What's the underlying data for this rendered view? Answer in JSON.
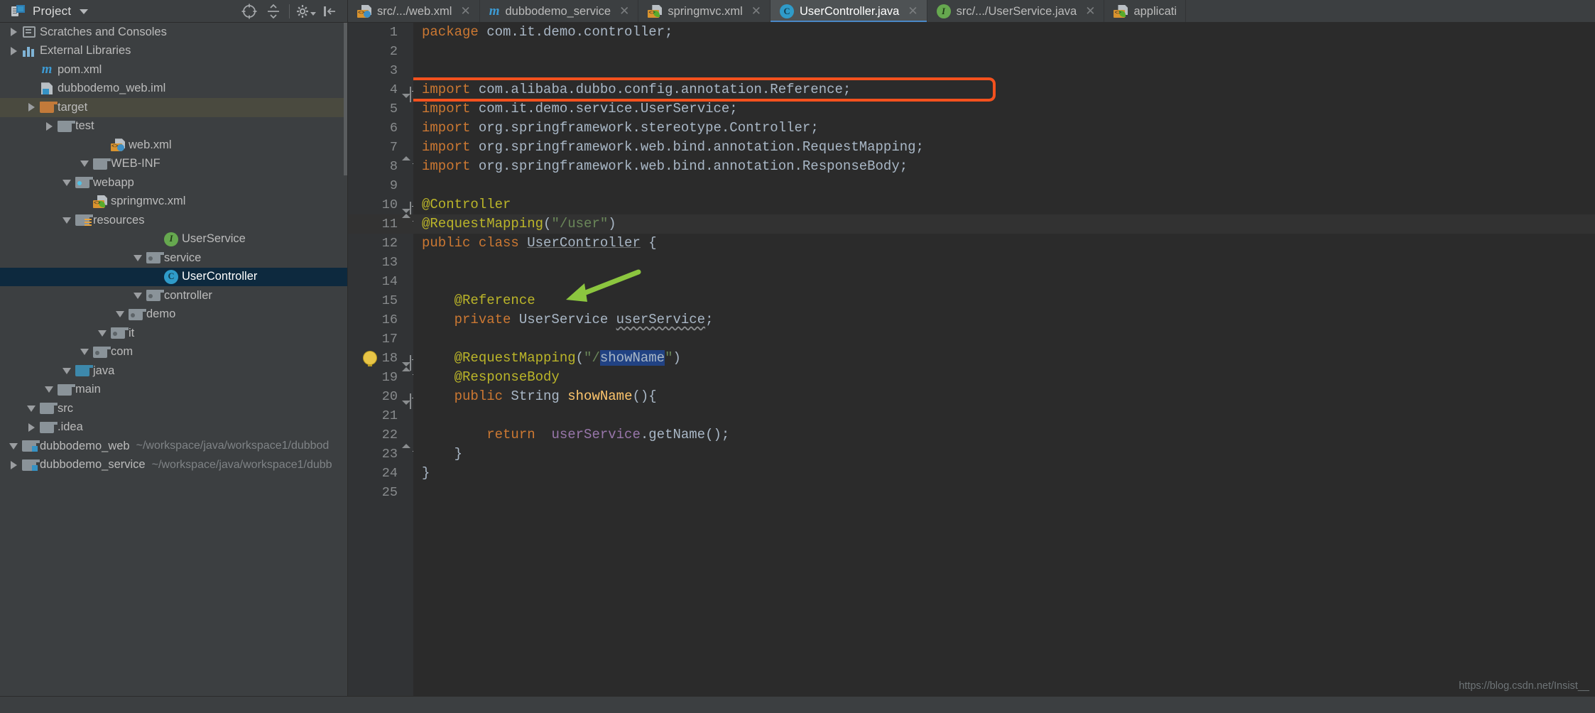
{
  "toolwindow": {
    "title": "Project",
    "icons": [
      "locate-icon",
      "collapse-all-icon",
      "settings-gear-icon",
      "hide-panel-icon"
    ]
  },
  "tabs": [
    {
      "label": "src/.../web.xml",
      "icon": "xml-web-file-icon",
      "active": false,
      "close": "✕"
    },
    {
      "label": "dubbodemo_service",
      "icon": "maven-module-icon",
      "active": false,
      "close": "✕"
    },
    {
      "label": "springmvc.xml",
      "icon": "spring-xml-file-icon",
      "active": false,
      "close": "✕"
    },
    {
      "label": "UserController.java",
      "icon": "java-class-icon",
      "active": true,
      "close": "✕"
    },
    {
      "label": "src/.../UserService.java",
      "icon": "java-interface-icon",
      "active": false,
      "close": "✕"
    },
    {
      "label": "applicati",
      "icon": "spring-xml-file-icon",
      "active": false,
      "close": ""
    }
  ],
  "tree": [
    {
      "label": "dubbodemo_service",
      "path": "~/workspace/java/workspace1/dubb",
      "indent": 0,
      "arrow": "right",
      "icon": "module-folder-icon"
    },
    {
      "label": "dubbodemo_web",
      "path": "~/workspace/java/workspace1/dubbod",
      "indent": 0,
      "arrow": "down",
      "icon": "module-folder-icon"
    },
    {
      "label": ".idea",
      "path": "",
      "indent": 1,
      "arrow": "right",
      "icon": "folder-icon"
    },
    {
      "label": "src",
      "path": "",
      "indent": 1,
      "arrow": "down",
      "icon": "folder-icon"
    },
    {
      "label": "main",
      "path": "",
      "indent": 2,
      "arrow": "down",
      "icon": "folder-icon"
    },
    {
      "label": "java",
      "path": "",
      "indent": 3,
      "arrow": "down",
      "icon": "source-root-folder-icon"
    },
    {
      "label": "com",
      "path": "",
      "indent": 4,
      "arrow": "down",
      "icon": "package-folder-icon"
    },
    {
      "label": "it",
      "path": "",
      "indent": 5,
      "arrow": "down",
      "icon": "package-folder-icon"
    },
    {
      "label": "demo",
      "path": "",
      "indent": 6,
      "arrow": "down",
      "icon": "package-folder-icon"
    },
    {
      "label": "controller",
      "path": "",
      "indent": 7,
      "arrow": "down",
      "icon": "package-folder-icon"
    },
    {
      "label": "UserController",
      "path": "",
      "indent": 8,
      "arrow": "none",
      "icon": "java-class-icon",
      "selected": true
    },
    {
      "label": "service",
      "path": "",
      "indent": 7,
      "arrow": "down",
      "icon": "package-folder-icon"
    },
    {
      "label": "UserService",
      "path": "",
      "indent": 8,
      "arrow": "none",
      "icon": "java-interface-icon"
    },
    {
      "label": "resources",
      "path": "",
      "indent": 3,
      "arrow": "down",
      "icon": "resource-root-folder-icon"
    },
    {
      "label": "springmvc.xml",
      "path": "",
      "indent": 4,
      "arrow": "none",
      "icon": "spring-xml-file-icon"
    },
    {
      "label": "webapp",
      "path": "",
      "indent": 3,
      "arrow": "down",
      "icon": "web-root-folder-icon"
    },
    {
      "label": "WEB-INF",
      "path": "",
      "indent": 4,
      "arrow": "down",
      "icon": "folder-icon"
    },
    {
      "label": "web.xml",
      "path": "",
      "indent": 5,
      "arrow": "none",
      "icon": "xml-web-file-icon"
    },
    {
      "label": "test",
      "path": "",
      "indent": 2,
      "arrow": "right",
      "icon": "folder-icon"
    },
    {
      "label": "target",
      "path": "",
      "indent": 1,
      "arrow": "right",
      "icon": "excluded-folder-icon",
      "highlight": true
    },
    {
      "label": "dubbodemo_web.iml",
      "path": "",
      "indent": 1,
      "arrow": "none",
      "icon": "iml-file-icon"
    },
    {
      "label": "pom.xml",
      "path": "",
      "indent": 1,
      "arrow": "none",
      "icon": "maven-pom-icon"
    },
    {
      "label": "External Libraries",
      "path": "",
      "indent": 0,
      "arrow": "right",
      "icon": "libraries-icon"
    },
    {
      "label": "Scratches and Consoles",
      "path": "",
      "indent": 0,
      "arrow": "right",
      "icon": "scratches-icon"
    }
  ],
  "editor": {
    "line_numbers": [
      "1",
      "2",
      "3",
      "4",
      "5",
      "6",
      "7",
      "8",
      "9",
      "10",
      "11",
      "12",
      "13",
      "14",
      "15",
      "16",
      "17",
      "18",
      "19",
      "20",
      "21",
      "22",
      "23",
      "24",
      "25"
    ],
    "current_line": 11,
    "lines": [
      {
        "n": 1,
        "tokens": [
          {
            "t": "package ",
            "c": "kw"
          },
          {
            "t": "com.it.demo.controller;",
            "c": "plain"
          }
        ]
      },
      {
        "n": 2,
        "tokens": []
      },
      {
        "n": 3,
        "tokens": []
      },
      {
        "n": 4,
        "tokens": [
          {
            "t": "import ",
            "c": "kw"
          },
          {
            "t": "com.alibaba.dubbo.config.annotation.",
            "c": "plain"
          },
          {
            "t": "Reference",
            "c": "type"
          },
          {
            "t": ";",
            "c": "plain"
          }
        ]
      },
      {
        "n": 5,
        "tokens": [
          {
            "t": "import ",
            "c": "kw"
          },
          {
            "t": "com.it.demo.service.",
            "c": "plain"
          },
          {
            "t": "UserService",
            "c": "type"
          },
          {
            "t": ";",
            "c": "plain"
          }
        ]
      },
      {
        "n": 6,
        "tokens": [
          {
            "t": "import ",
            "c": "kw"
          },
          {
            "t": "org.springframework.stereotype.",
            "c": "plain"
          },
          {
            "t": "Controller",
            "c": "type"
          },
          {
            "t": ";",
            "c": "plain"
          }
        ]
      },
      {
        "n": 7,
        "tokens": [
          {
            "t": "import ",
            "c": "kw"
          },
          {
            "t": "org.springframework.web.bind.annotation.",
            "c": "plain"
          },
          {
            "t": "RequestMapping",
            "c": "type"
          },
          {
            "t": ";",
            "c": "plain"
          }
        ]
      },
      {
        "n": 8,
        "tokens": [
          {
            "t": "import ",
            "c": "kw"
          },
          {
            "t": "org.springframework.web.bind.annotation.",
            "c": "plain"
          },
          {
            "t": "ResponseBody",
            "c": "type"
          },
          {
            "t": ";",
            "c": "plain"
          }
        ]
      },
      {
        "n": 9,
        "tokens": []
      },
      {
        "n": 10,
        "tokens": [
          {
            "t": "@Controller",
            "c": "ann"
          }
        ]
      },
      {
        "n": 11,
        "tokens": [
          {
            "t": "@RequestMapping",
            "c": "ann"
          },
          {
            "t": "(",
            "c": "plain"
          },
          {
            "t": "\"/user\"",
            "c": "str"
          },
          {
            "t": ")",
            "c": "plain"
          }
        ]
      },
      {
        "n": 12,
        "tokens": [
          {
            "t": "public class ",
            "c": "kw"
          },
          {
            "t": "UserController",
            "c": "uline"
          },
          {
            "t": " {",
            "c": "plain"
          }
        ]
      },
      {
        "n": 13,
        "tokens": []
      },
      {
        "n": 14,
        "tokens": []
      },
      {
        "n": 15,
        "tokens": [
          {
            "t": "    @Reference",
            "c": "ann"
          }
        ]
      },
      {
        "n": 16,
        "tokens": [
          {
            "t": "    private ",
            "c": "kw"
          },
          {
            "t": "UserService ",
            "c": "plain"
          },
          {
            "t": "userService",
            "c": "wavy"
          },
          {
            "t": ";",
            "c": "plain"
          }
        ]
      },
      {
        "n": 17,
        "tokens": []
      },
      {
        "n": 18,
        "tokens": [
          {
            "t": "    @RequestMapping",
            "c": "ann"
          },
          {
            "t": "(",
            "c": "plain"
          },
          {
            "t": "\"/",
            "c": "str"
          },
          {
            "t": "showName",
            "c": "sel"
          },
          {
            "t": "\"",
            "c": "str"
          },
          {
            "t": ")",
            "c": "plain"
          }
        ]
      },
      {
        "n": 19,
        "tokens": [
          {
            "t": "    @ResponseBody",
            "c": "ann"
          }
        ]
      },
      {
        "n": 20,
        "tokens": [
          {
            "t": "    public ",
            "c": "kw"
          },
          {
            "t": "String ",
            "c": "plain"
          },
          {
            "t": "showName",
            "c": "ident"
          },
          {
            "t": "(){",
            "c": "plain"
          }
        ]
      },
      {
        "n": 21,
        "tokens": []
      },
      {
        "n": 22,
        "tokens": [
          {
            "t": "        return ",
            "c": "kw"
          },
          {
            "t": " ",
            "c": "plain"
          },
          {
            "t": "userService",
            "c": "fld"
          },
          {
            "t": ".getName();",
            "c": "plain"
          }
        ]
      },
      {
        "n": 23,
        "tokens": [
          {
            "t": "    }",
            "c": "plain"
          }
        ]
      },
      {
        "n": 24,
        "tokens": [
          {
            "t": "}",
            "c": "plain"
          }
        ]
      },
      {
        "n": 25,
        "tokens": []
      }
    ]
  },
  "annotations": {
    "highlight_box_line": 4,
    "highlight_box_color": "#f4511e",
    "arrow_color": "#8cc63f",
    "arrow_target_line": 15
  },
  "watermark": "https://blog.csdn.net/Insist__",
  "colors": {
    "editor_bg": "#2b2b2b",
    "panel_bg": "#3c3f41",
    "gutter_bg": "#313335",
    "selection_tree": "#0d293e",
    "tab_active": "#4e5254",
    "accent_blue": "#4a88c7",
    "keyword": "#cc7832",
    "annotation": "#bbb529",
    "string": "#6a8759",
    "field": "#9876aa",
    "method": "#ffc66d",
    "text": "#a9b7c6"
  }
}
